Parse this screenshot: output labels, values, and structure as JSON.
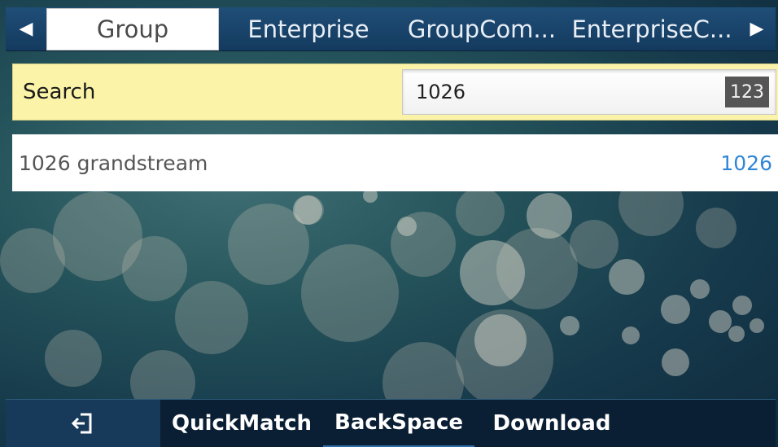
{
  "tabs": {
    "prev_arrow": "◀",
    "next_arrow": "▶",
    "items": [
      {
        "label": "Group"
      },
      {
        "label": "Enterprise"
      },
      {
        "label": "GroupCom..."
      },
      {
        "label": "EnterpriseC..."
      }
    ],
    "active_index": 0
  },
  "search": {
    "label": "Search",
    "value": "1026",
    "input_mode": "123"
  },
  "results": [
    {
      "name": "1026 grandstream",
      "number": "1026"
    }
  ],
  "softkeys": {
    "exit_icon": "exit-icon",
    "items": [
      {
        "label": "QuickMatch"
      },
      {
        "label": "BackSpace"
      },
      {
        "label": "Download"
      }
    ]
  },
  "colors": {
    "tab_bar": "#1f4e78",
    "search_row": "#fbf4a8",
    "result_number": "#2f86d6",
    "softkey_bar": "#0a1f33"
  }
}
